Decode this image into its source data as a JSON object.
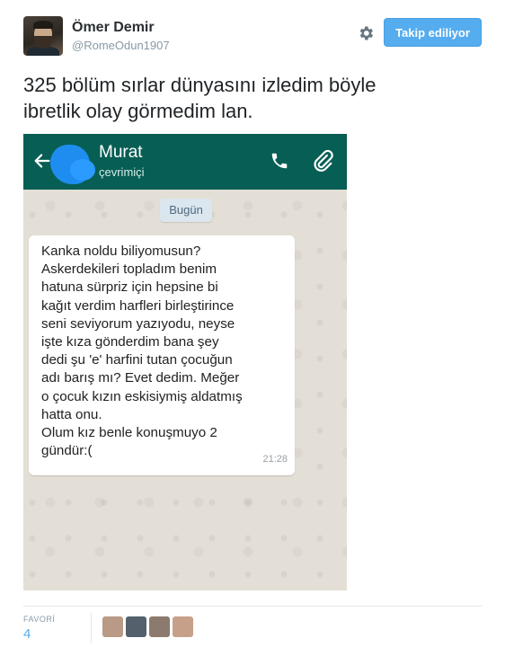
{
  "tweet": {
    "author_name": "Ömer Demir",
    "author_handle": "@RomeOdun1907",
    "follow_button_label": "Takip ediliyor",
    "text_line1": "325 bölüm sırlar dünyasını izledim böyle",
    "text_line2": "ibretlik olay görmedim lan.",
    "icons": [
      "gear-icon"
    ]
  },
  "whatsapp": {
    "contact_name": "Murat",
    "contact_status": "çevrimiçi",
    "date_chip": "Bugün",
    "message": "Kanka noldu biliyomusun?\nAskerdekileri topladım benim\nhatuna sürpriz için hepsine bi\nkağıt verdim harfleri birleştirince\nseni seviyorum yazıyodu, neyse\nişte kıza gönderdim bana şey\ndedi şu 'e' harfini tutan çocuğun\nadı barış mı? Evet dedim. Meğer\no çocuk kızın eskisiymiş aldatmış\nhatta onu.\nOlum kız benle konuşmuyo 2\ngündür:(",
    "message_time": "21:28",
    "header_color": "#075e54",
    "icons": [
      "back-arrow-icon",
      "phone-icon",
      "paperclip-icon"
    ]
  },
  "stats": {
    "favorites_label": "FAVORİ",
    "favorites_count": "4",
    "avatar_colors": [
      "#b89a86",
      "#54606b",
      "#8c7a6e",
      "#c7a08a"
    ]
  },
  "colors": {
    "accent": "#55acee",
    "text": "#292f33",
    "muted": "#8899a6"
  }
}
